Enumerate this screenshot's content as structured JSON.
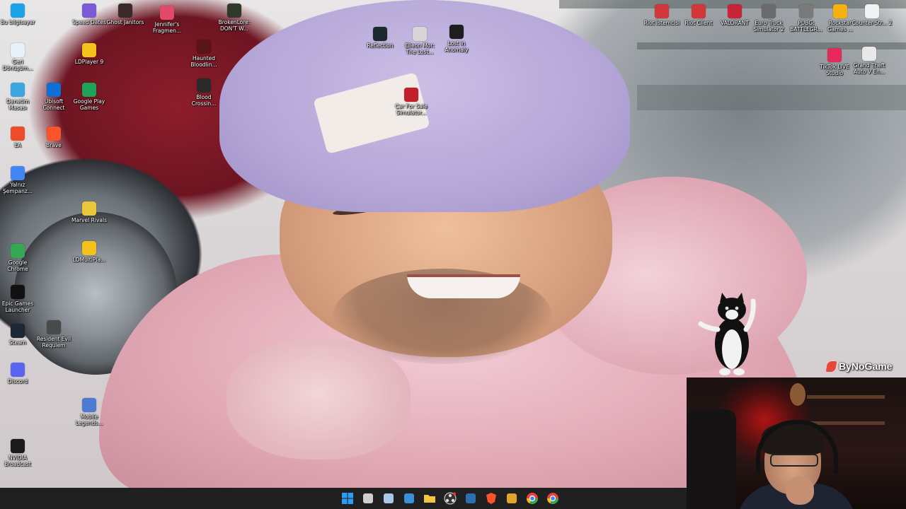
{
  "desktop": {
    "icons": [
      {
        "id": "bu-bilgisayar",
        "label": "Bu bilgisayar",
        "icon": "computer-icon",
        "color": "#1aa3e8"
      },
      {
        "id": "geri-donusum",
        "label": "Geri Dönüşüm...",
        "icon": "recycle-bin-icon",
        "color": "#e9f1f8"
      },
      {
        "id": "denetim-masasi",
        "label": "Denetim Masası",
        "icon": "control-panel-icon",
        "color": "#3ca6e0"
      },
      {
        "id": "ea",
        "label": "EA",
        "icon": "ea-app-icon",
        "color": "#ee4b2b"
      },
      {
        "id": "yalniz-sempanze",
        "label": "Yalnız Şempanz...",
        "icon": "chrome-app-icon",
        "color": "#4285f4"
      },
      {
        "id": "google-chrome",
        "label": "Google Chrome",
        "icon": "google-chrome-icon",
        "color": "#34a853"
      },
      {
        "id": "epic-games",
        "label": "Epic Games Launcher",
        "icon": "epic-games-icon",
        "color": "#111111"
      },
      {
        "id": "steam",
        "label": "Steam",
        "icon": "steam-icon",
        "color": "#1b2838"
      },
      {
        "id": "discord",
        "label": "Discord",
        "icon": "discord-icon",
        "color": "#5865f2"
      },
      {
        "id": "nvidia-broadcast",
        "label": "NVIDIA Broadcast",
        "icon": "nvidia-icon",
        "color": "#1a1a1a"
      },
      {
        "id": "speed-dates",
        "label": "Speed Dates",
        "icon": "speed-dates-icon",
        "color": "#7a5ad6"
      },
      {
        "id": "ldplayer9",
        "label": "LDPlayer 9",
        "icon": "ldplayer-icon",
        "color": "#f4c21b"
      },
      {
        "id": "ubisoft-connect",
        "label": "Ubisoft Connect",
        "icon": "ubisoft-icon",
        "color": "#0f6fd6"
      },
      {
        "id": "brave",
        "label": "Brave",
        "icon": "brave-icon",
        "color": "#fb542b"
      },
      {
        "id": "resident-evil",
        "label": "Resident Evil Requiem",
        "icon": "resident-evil-icon",
        "color": "#4a4a4a"
      },
      {
        "id": "ghost-janitors",
        "label": "Ghost Janitors",
        "icon": "ghost-janitors-icon",
        "color": "#3c2a2a"
      },
      {
        "id": "google-play-games",
        "label": "Google Play Games",
        "icon": "google-play-games-icon",
        "color": "#1fa35a"
      },
      {
        "id": "marvel-rivals",
        "label": "Marvel Rivals",
        "icon": "marvel-rivals-icon",
        "color": "#e9c73a"
      },
      {
        "id": "ldmultiplayer",
        "label": "LDMultiPla...",
        "icon": "ldmultiplayer-icon",
        "color": "#f4c21b"
      },
      {
        "id": "mobile-legends",
        "label": "Mobile Legends...",
        "icon": "mobile-legends-icon",
        "color": "#4c7bd1"
      },
      {
        "id": "jennifers-fragments",
        "label": "Jennifer's Fragmen...",
        "icon": "jennifers-fragments-icon",
        "color": "#e24a6a"
      },
      {
        "id": "haunted-bloodlines",
        "label": "Haunted Bloodlin...",
        "icon": "haunted-bloodlines-icon",
        "color": "#5a1414"
      },
      {
        "id": "blood-crossing",
        "label": "Blood Crossin...",
        "icon": "blood-crossing-icon",
        "color": "#2a2a2a"
      },
      {
        "id": "broken-lore",
        "label": "BrokenLore: DON'T W...",
        "icon": "broken-lore-icon",
        "color": "#2f3a2a"
      },
      {
        "id": "reflection",
        "label": "Reflection",
        "icon": "reflection-icon",
        "color": "#1c2a30"
      },
      {
        "id": "elleon-mor",
        "label": "Elleon Mor: The Lost...",
        "icon": "elleon-mor-icon",
        "color": "#d6d6d6"
      },
      {
        "id": "lost-in-anomaly",
        "label": "Lost in Anomaly",
        "icon": "lost-in-anomaly-icon",
        "color": "#1e1e1e"
      },
      {
        "id": "car-for-sale",
        "label": "Car For Sale Simulator...",
        "icon": "car-for-sale-icon",
        "color": "#c0202a"
      },
      {
        "id": "riot-istemcisi",
        "label": "Riot İstemcisi",
        "icon": "riot-client-icon",
        "color": "#d13639"
      },
      {
        "id": "riot-client",
        "label": "Riot Client",
        "icon": "riot-client-icon",
        "color": "#d13639"
      },
      {
        "id": "valorant",
        "label": "VALORANT",
        "icon": "valorant-icon",
        "color": "#c7243a"
      },
      {
        "id": "euro-truck",
        "label": "Euro Truck Simulator 2",
        "icon": "euro-truck-icon",
        "color": "#6b6b6b"
      },
      {
        "id": "pubg",
        "label": "PUBG: BATTLEGR...",
        "icon": "pubg-icon",
        "color": "#7a7a7a"
      },
      {
        "id": "rockstar-games",
        "label": "Rockstar Games ...",
        "icon": "rockstar-icon",
        "color": "#f6b10e"
      },
      {
        "id": "counter-strike-2",
        "label": "Counter-Str... 2",
        "icon": "counter-strike-icon",
        "color": "#f2f2f2"
      },
      {
        "id": "tiktok-live",
        "label": "TikTok LIVE Studio",
        "icon": "tiktok-live-icon",
        "color": "#e5295b"
      },
      {
        "id": "gta-v",
        "label": "Grand Theft Auto V En...",
        "icon": "gta-v-icon",
        "color": "#e8e8e8"
      }
    ]
  },
  "overlay": {
    "watermark": "ByNoGame"
  },
  "taskbar": {
    "items": [
      {
        "id": "start",
        "icon": "windows-start-icon",
        "color": "#2b9df4"
      },
      {
        "id": "task-view",
        "icon": "task-view-icon",
        "color": "#cfcfcf"
      },
      {
        "id": "snipping",
        "icon": "snipping-tool-icon",
        "color": "#a9c6e8"
      },
      {
        "id": "photos",
        "icon": "photos-icon",
        "color": "#3a8fd6"
      },
      {
        "id": "file-explorer",
        "icon": "file-explorer-icon",
        "color": "#f4c542"
      },
      {
        "id": "obs",
        "icon": "obs-icon",
        "color": "#2d2d2d"
      },
      {
        "id": "steam-tb",
        "icon": "steam-icon",
        "color": "#2a6fb0"
      },
      {
        "id": "brave-tb",
        "icon": "brave-icon",
        "color": "#fb542b"
      },
      {
        "id": "media-player",
        "icon": "media-player-icon",
        "color": "#e0a52a"
      },
      {
        "id": "chrome-tb-1",
        "icon": "google-chrome-icon",
        "color": "#34a853"
      },
      {
        "id": "chrome-tb-2",
        "icon": "google-chrome-icon",
        "color": "#ea4335"
      }
    ]
  }
}
